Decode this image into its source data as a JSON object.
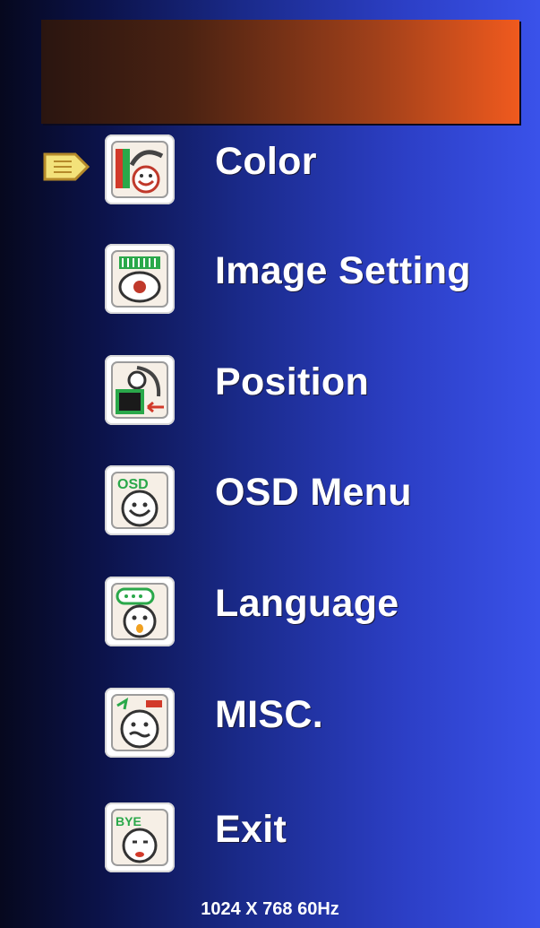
{
  "menu": {
    "items": [
      {
        "label": "Color",
        "icon": "color-icon",
        "selected": true
      },
      {
        "label": "Image Setting",
        "icon": "image-setting-icon",
        "selected": false
      },
      {
        "label": "Position",
        "icon": "position-icon",
        "selected": false
      },
      {
        "label": "OSD Menu",
        "icon": "osd-menu-icon",
        "selected": false
      },
      {
        "label": "Language",
        "icon": "language-icon",
        "selected": false
      },
      {
        "label": "MISC.",
        "icon": "misc-icon",
        "selected": false
      },
      {
        "label": "Exit",
        "icon": "exit-icon",
        "selected": false
      }
    ]
  },
  "icon_text": {
    "osd": "OSD",
    "exit": "BYE"
  },
  "status": {
    "resolution": "1024 X 768  60Hz"
  },
  "colors": {
    "background_left": "#06081e",
    "background_right": "#3a52ea",
    "title_bar_left": "#2a1510",
    "title_bar_right": "#f05a1e",
    "pointer": "#f3e27a",
    "label": "#ffffff"
  }
}
